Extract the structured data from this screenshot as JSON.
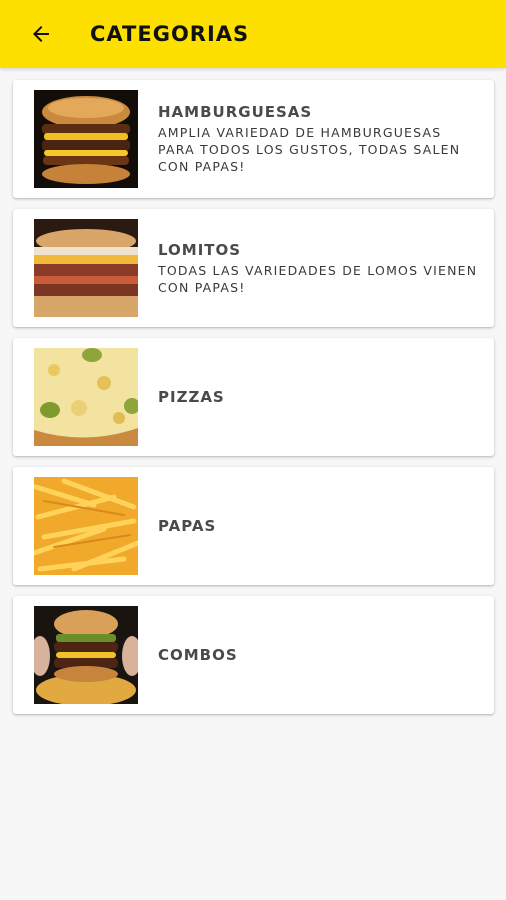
{
  "appbar": {
    "title": "CATEGORIAS",
    "back_icon": "arrow-left-icon",
    "color": "#fde000"
  },
  "categories": [
    {
      "name": "HAMBURGUESAS",
      "description": "AMPLIA VARIEDAD DE HAMBURGUESAS PARA TODOS LOS GUSTOS, TODAS SALEN CON PAPAS!",
      "image": "burger-image"
    },
    {
      "name": "LOMITOS",
      "description": "TODAS LAS VARIEDADES DE LOMOS VIENEN CON PAPAS!",
      "image": "lomito-sandwich-image"
    },
    {
      "name": "PIZZAS",
      "description": "",
      "image": "pizza-image"
    },
    {
      "name": "PAPAS",
      "description": "",
      "image": "fries-image"
    },
    {
      "name": "COMBOS",
      "description": "",
      "image": "combo-burger-fries-image"
    }
  ]
}
